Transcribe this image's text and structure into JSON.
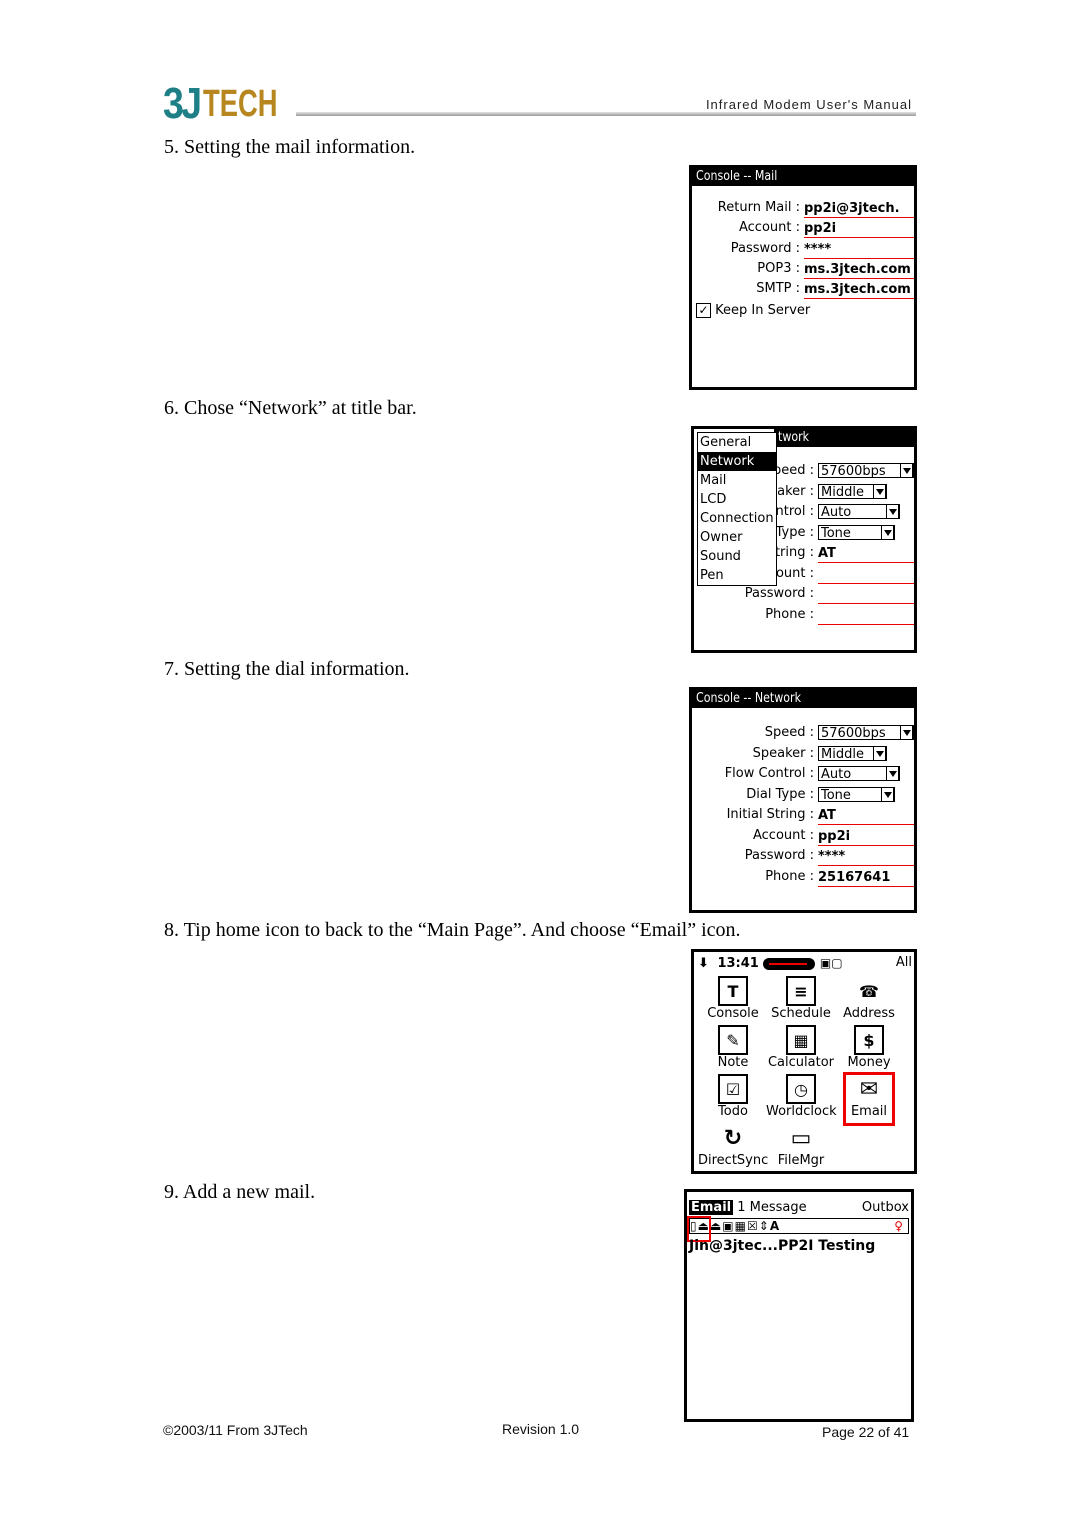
{
  "header": {
    "logo_number": "3J",
    "logo_word": "TECH",
    "title": "Infrared Modem User's Manual"
  },
  "steps": [
    "5. Setting the mail information.",
    "6. Chose “Network” at title bar.",
    "7. Setting the dial information.",
    "8. Tip home icon to back to the “Main Page”. And choose “Email” icon.",
    "9. Add a new mail."
  ],
  "mail_screen": {
    "title": "Console -- Mail",
    "fields": [
      {
        "label": "Return Mail :",
        "value": "pp2i@3jtech."
      },
      {
        "label": "Account :",
        "value": "pp2i"
      },
      {
        "label": "Password :",
        "value": "****"
      },
      {
        "label": "POP3 :",
        "value": "ms.3jtech.com"
      },
      {
        "label": "SMTP :",
        "value": "ms.3jtech.com"
      }
    ],
    "checkbox_label": "Keep In Server",
    "checkbox_checked": true
  },
  "menu_screen": {
    "title_fragment": "twork",
    "menu_items": [
      "General",
      "Network",
      "Mail",
      "LCD",
      "Connection",
      "Owner",
      "Sound",
      "Pen"
    ],
    "selected": "Network",
    "partial_labels": [
      "peed :",
      "aker :",
      "ntrol :",
      "Type :",
      "tring :",
      "ount :",
      "Password :",
      "Phone :"
    ],
    "values": {
      "speed": "57600bps",
      "speaker": "Middle",
      "flow": "Auto",
      "dial": "Tone",
      "init": "AT"
    }
  },
  "network_screen": {
    "title": "Console -- Network",
    "dropdowns": [
      {
        "label": "Speed :",
        "value": "57600bps"
      },
      {
        "label": "Speaker :",
        "value": "Middle"
      },
      {
        "label": "Flow Control :",
        "value": "Auto"
      },
      {
        "label": "Dial Type :",
        "value": "Tone"
      }
    ],
    "fields": [
      {
        "label": "Initial String :",
        "value": "AT"
      },
      {
        "label": "Account :",
        "value": "pp2i"
      },
      {
        "label": "Password :",
        "value": "****"
      },
      {
        "label": "Phone :",
        "value": "25167641"
      }
    ]
  },
  "home_screen": {
    "time": "13:41",
    "category": "All",
    "apps": [
      {
        "name": "Console",
        "glyph": "T"
      },
      {
        "name": "Schedule",
        "glyph": "≡"
      },
      {
        "name": "Address",
        "glyph": "☎"
      },
      {
        "name": "Note",
        "glyph": "✎"
      },
      {
        "name": "Calculator",
        "glyph": "▦"
      },
      {
        "name": "Money",
        "glyph": "$"
      },
      {
        "name": "Todo",
        "glyph": "☑"
      },
      {
        "name": "Worldclock",
        "glyph": "◷"
      },
      {
        "name": "Email",
        "glyph": "✉"
      },
      {
        "name": "DirectSync",
        "glyph": "↻"
      },
      {
        "name": "FileMgr",
        "glyph": "▭"
      }
    ],
    "highlighted": "Email"
  },
  "email_screen": {
    "title": "Email",
    "count": "1 Message",
    "folder": "Outbox",
    "toolbar": [
      "new-mail",
      "receive",
      "send",
      "inbox",
      "outbox",
      "delete",
      "sort",
      "font",
      "tip"
    ],
    "messages": [
      "Jin@3jtec...PP2I Testing"
    ]
  },
  "footer": {
    "copyright": "©2003/11 From 3JTech",
    "revision": "Revision 1.0",
    "page": "Page 22 of 41"
  },
  "colors": {
    "accent_red": "#e00000",
    "logo_teal": "#1f7f87",
    "logo_gold": "#b7861e"
  }
}
